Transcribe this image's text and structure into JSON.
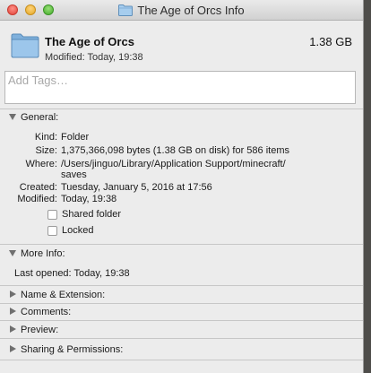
{
  "window": {
    "title": "The Age of Orcs Info"
  },
  "header": {
    "name": "The Age of Orcs",
    "size": "1.38 GB",
    "modified": "Modified: Today, 19:38"
  },
  "tags": {
    "placeholder": "Add Tags…"
  },
  "general": {
    "label": "General:",
    "rows": [
      {
        "label": "Kind:",
        "value": "Folder"
      },
      {
        "label": "Size:",
        "value": "1,375,366,098 bytes (1.38 GB on disk) for 586 items"
      },
      {
        "label": "Where:",
        "value": "/Users/jinguo/Library/Application Support/minecraft/",
        "value2": "saves"
      },
      {
        "label": "Created:",
        "value": "Tuesday, January 5, 2016 at 17:56"
      },
      {
        "label": "Modified:",
        "value": "Today, 19:38"
      }
    ],
    "shared_folder_label": "Shared folder",
    "shared_folder_checked": false,
    "locked_label": "Locked",
    "locked_checked": false
  },
  "more_info": {
    "label": "More Info:",
    "last_opened": "Last opened: Today, 19:38"
  },
  "collapsed_sections": [
    {
      "label": "Name & Extension:"
    },
    {
      "label": "Comments:"
    },
    {
      "label": "Preview:"
    },
    {
      "label": "Sharing & Permissions:"
    }
  ],
  "colors": {
    "folder": "#8cb9e0",
    "window_bg": "#ececec"
  },
  "icons": [
    "folder-icon",
    "close-icon",
    "minimize-icon",
    "zoom-icon",
    "disclosure-triangle-icon",
    "checkbox-icon"
  ]
}
